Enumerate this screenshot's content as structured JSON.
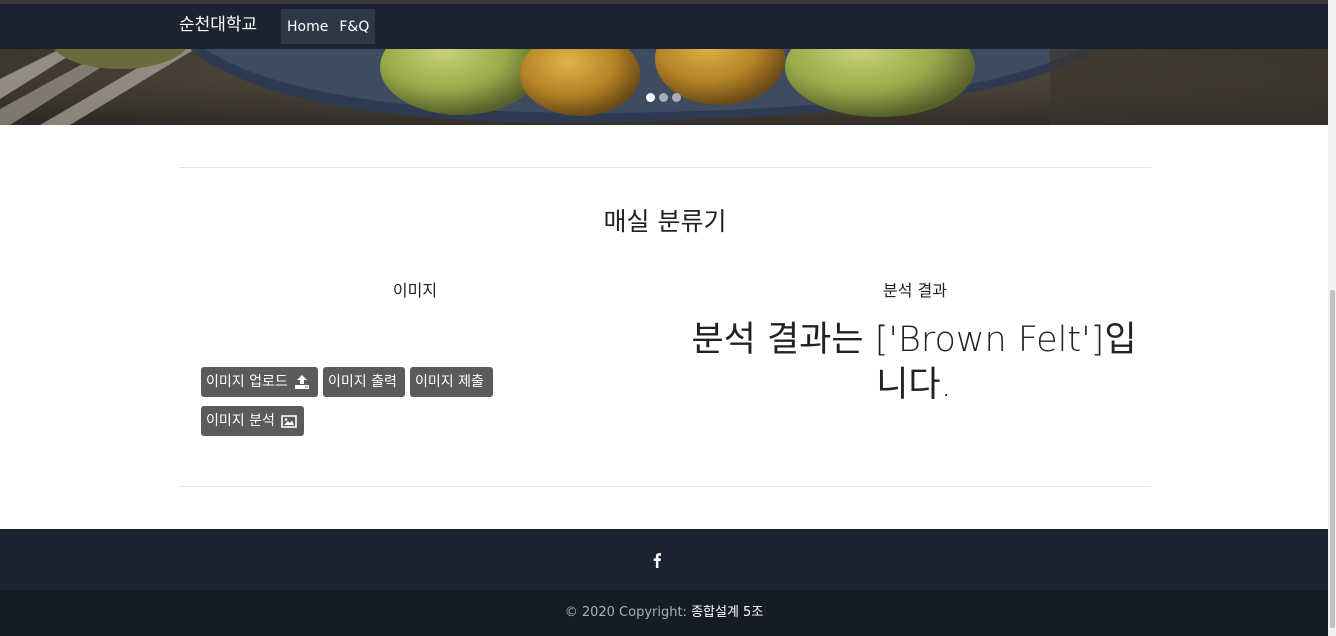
{
  "navbar": {
    "brand": "순천대학교",
    "links": [
      "Home",
      "F&Q"
    ]
  },
  "carousel": {
    "indicator_count": 3,
    "active_index": 0
  },
  "main": {
    "title": "매실 분류기",
    "image_column": {
      "heading": "이미지",
      "buttons": {
        "upload": "이미지 업로드",
        "print": "이미지 출력",
        "submit": "이미지 제출",
        "analyze": "이미지 분석"
      }
    },
    "result_column": {
      "heading": "분석 결과",
      "result_text": "분석 결과는 ['Brown Felt']입니다."
    }
  },
  "footer": {
    "social_icon": "facebook-icon",
    "copyright_prefix": "© 2020 Copyright: ",
    "copyright_link": "종합설계 5조"
  },
  "colors": {
    "navbar_bg": "#1d2431",
    "footer_bottom_bg": "#161c27",
    "button_bg": "#5b5b5b"
  }
}
